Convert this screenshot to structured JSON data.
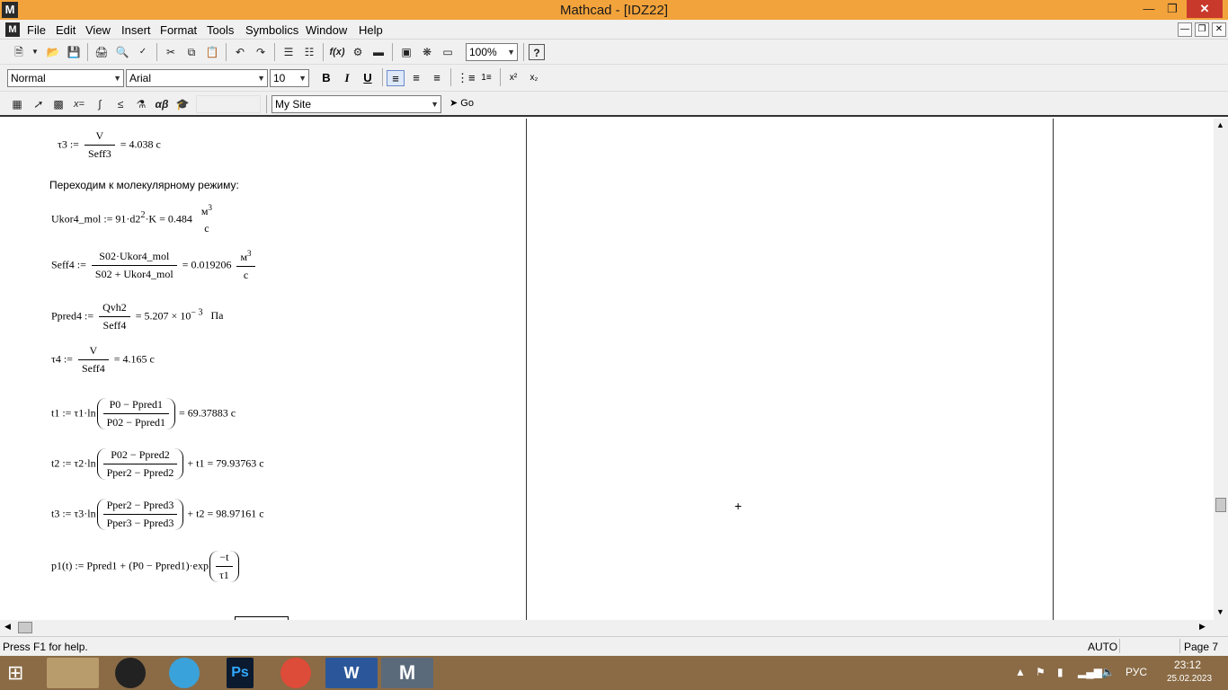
{
  "window": {
    "title": "Mathcad - [IDZ22]",
    "app_icon": "M"
  },
  "menu": [
    "File",
    "Edit",
    "View",
    "Insert",
    "Format",
    "Tools",
    "Symbolics",
    "Window",
    "Help"
  ],
  "toolbar": {
    "zoom": "100%"
  },
  "format_bar": {
    "style": "Normal",
    "font": "Arial",
    "size": "10",
    "bold": "B",
    "italic": "I",
    "underline": "U"
  },
  "math_bar": {
    "resource": "My Site",
    "go_label": "Go"
  },
  "doc": {
    "l1_lhs": "τ3 :=",
    "l1_num": "V",
    "l1_den": "Seff3",
    "l1_rhs": "= 4.038  c",
    "heading": "Переходим к молекулярному режиму:",
    "l2_lhs": "Ukor4_mol := 91·d2",
    "l2_exp": "2",
    "l2_mid": "·K = 0.484",
    "l2_unum": "м",
    "l2_uexp": "3",
    "l2_uden": "c",
    "l3_lhs": "Seff4 :=",
    "l3_num": "S02·Ukor4_mol",
    "l3_den": "S02 + Ukor4_mol",
    "l3_rhs": "= 0.019206",
    "l3_unum": "м",
    "l3_uexp": "3",
    "l3_uden": "c",
    "l4_lhs": "Ppred4 :=",
    "l4_num": "Qvh2",
    "l4_den": "Seff4",
    "l4_rhs": "= 5.207 × 10",
    "l4_exp": "− 3",
    "l4_unit": "Па",
    "l5_lhs": "τ4 :=",
    "l5_num": "V",
    "l5_den": "Seff4",
    "l5_rhs": "= 4.165  c",
    "l6_lhs": "t1 := τ1·ln",
    "l6_num": "P0 − Ppred1",
    "l6_den": "P02 − Ppred1",
    "l6_rhs": "= 69.37883  c",
    "l7_lhs": "t2 := τ2·ln",
    "l7_num": "P02 − Ppred2",
    "l7_den": "Pper2 − Ppred2",
    "l7_rhs": "+ t1 = 79.93763 c",
    "l8_lhs": "t3 := τ3·ln",
    "l8_num": "Pper2 − Ppred3",
    "l8_den": "Pper3 − Ppred3",
    "l8_rhs": "+ t2 = 98.97161 c",
    "l9_lhs": "p1(t) := Ppred1 + (P0 − Ppred1)·exp",
    "l9_num": "−t",
    "l9_den": "τ1"
  },
  "status": {
    "help": "Press F1 for help.",
    "mode": "AUTO",
    "page": "Page 7"
  },
  "taskbar": {
    "lang": "РУС",
    "time": "23:12",
    "date": "25.02.2023"
  },
  "colors": {
    "titlebar": "#f3a33b",
    "close": "#c8392b",
    "taskbar": "#8a6b45"
  }
}
